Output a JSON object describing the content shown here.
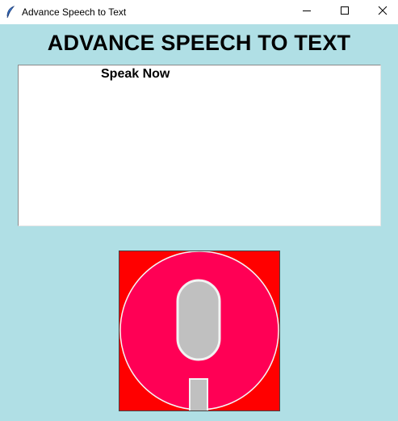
{
  "window": {
    "title": "Advance Speech to Text",
    "app_icon": "feather-icon",
    "controls": {
      "minimize_icon": "minimize-icon",
      "maximize_icon": "maximize-icon",
      "close_icon": "close-icon"
    }
  },
  "main": {
    "heading": "ADVANCE SPEECH TO TEXT",
    "text_area": {
      "label": "Speak Now"
    },
    "mic_button": {
      "icon": "microphone-icon",
      "colors": {
        "background": "#ff0000",
        "circle": "#ff0055",
        "capsule": "#c0c0c0",
        "capsule_outline": "#f2f2f2"
      }
    }
  },
  "colors": {
    "window_background": "#b0dfe5",
    "titlebar": "#ffffff"
  }
}
